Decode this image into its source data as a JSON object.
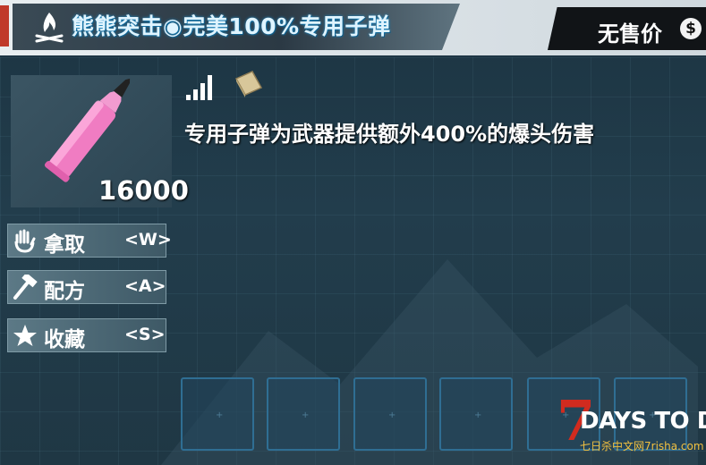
{
  "header": {
    "title": "熊熊突击◉完美100%专用子弹",
    "price_label": "无售价",
    "currency_symbol": "$"
  },
  "item": {
    "count": "16000",
    "description": "专用子弹为武器提供额外400%的爆头伤害",
    "icon": "pink-bullet-icon",
    "quality_icon": "signal-bars-icon",
    "info_icon": "book-icon"
  },
  "actions": [
    {
      "label": "拿取",
      "key": "<W>",
      "icon": "hand-icon"
    },
    {
      "label": "配方",
      "key": "<A>",
      "icon": "hammer-icon"
    },
    {
      "label": "收藏",
      "key": "<S>",
      "icon": "star-icon"
    }
  ],
  "slots": [
    "",
    "",
    "",
    "",
    "",
    ""
  ],
  "watermark": {
    "logo_number": "7",
    "logo_text": "DAYS TO DIE",
    "site": "七日杀中文网7risha.com"
  },
  "colors": {
    "panel_bg": "#223d4c",
    "title_glow": "#1b8cc8",
    "slot_border": "#2f6e93",
    "bullet_pink": "#f07cc2",
    "logo_red": "#d12b1f"
  }
}
